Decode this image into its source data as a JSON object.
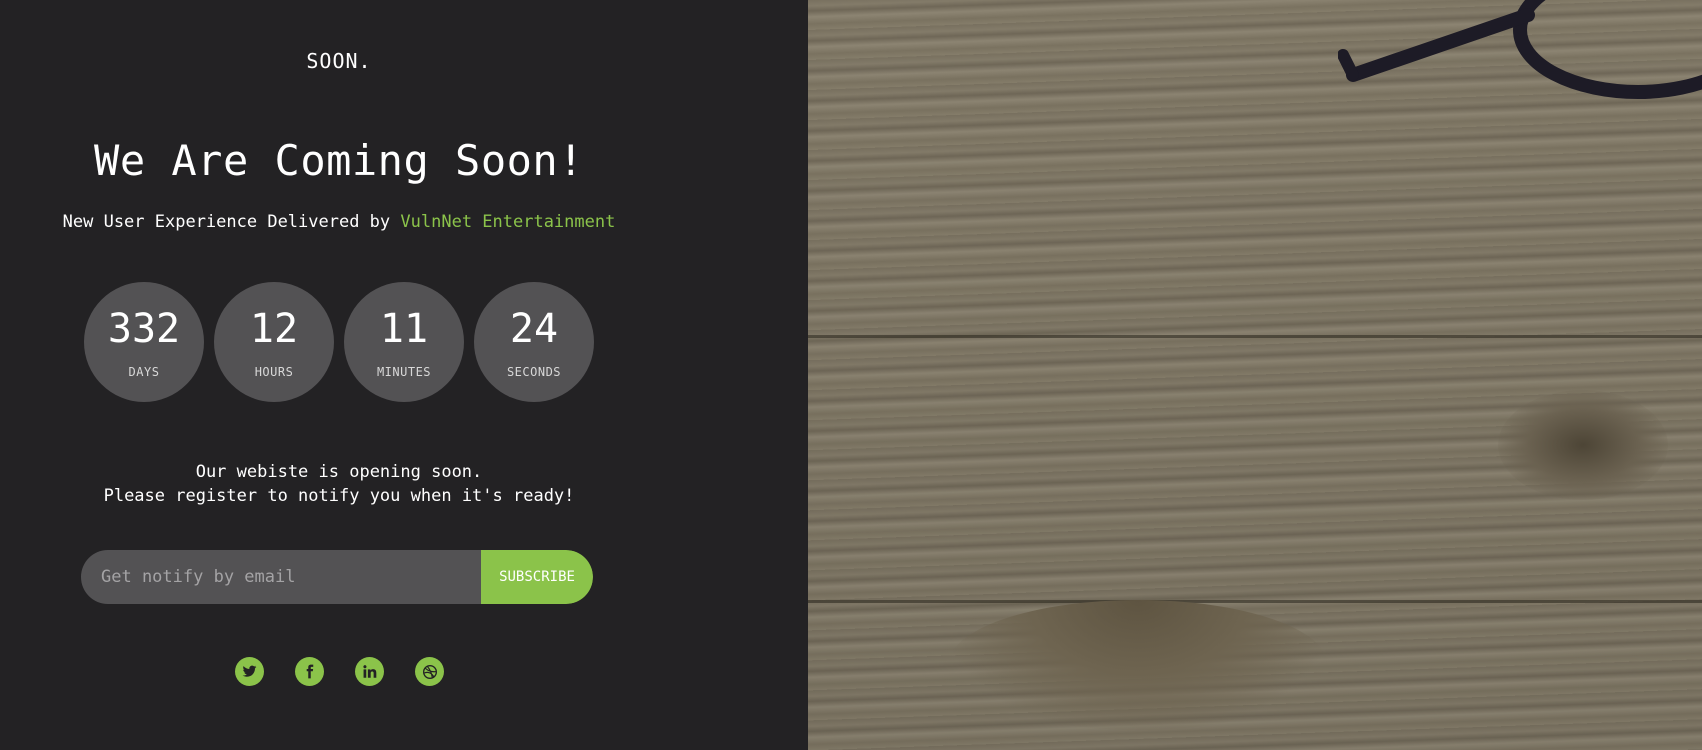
{
  "logo": "SOON.",
  "headline": "We Are Coming Soon!",
  "tagline": {
    "prefix": "New User Experience Delivered by ",
    "brand": "VulnNet Entertainment"
  },
  "countdown": [
    {
      "value": "332",
      "label": "DAYS"
    },
    {
      "value": "12",
      "label": "HOURS"
    },
    {
      "value": "11",
      "label": "MINUTES"
    },
    {
      "value": "24",
      "label": "SECONDS"
    }
  ],
  "message": {
    "line1": "Our webiste is opening soon.",
    "line2": "Please register to notify you when it's ready!"
  },
  "subscribe": {
    "placeholder": "Get notify by email",
    "button_label": "SUBSCRIBE"
  },
  "socials": [
    {
      "icon": "twitter-icon"
    },
    {
      "icon": "facebook-icon"
    },
    {
      "icon": "linkedin-icon"
    },
    {
      "icon": "dribbble-icon"
    }
  ],
  "colors": {
    "accent": "#8bc34a",
    "background": "#232224",
    "circle": "#535254"
  }
}
